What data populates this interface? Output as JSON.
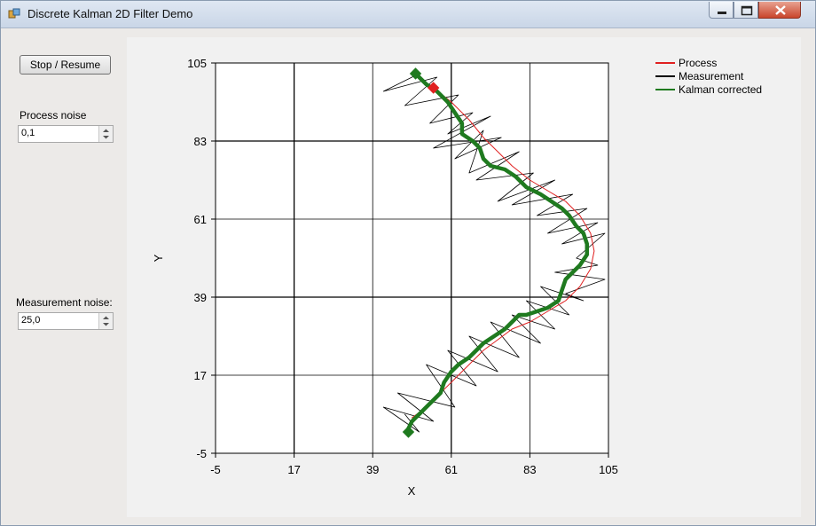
{
  "window": {
    "title": "Discrete Kalman 2D Filter Demo"
  },
  "controls": {
    "stop_resume_label": "Stop / Resume",
    "process_noise_label": "Process noise",
    "process_noise_value": "0,1",
    "measurement_noise_label": "Measurement noise:",
    "measurement_noise_value": "25,0"
  },
  "chart_data": {
    "type": "line",
    "title": "",
    "xlabel": "X",
    "ylabel": "Y",
    "xlim": [
      -5,
      105
    ],
    "ylim": [
      -5,
      105
    ],
    "x_ticks": [
      -5,
      17,
      39,
      61,
      83,
      105
    ],
    "y_ticks": [
      -5,
      17,
      39,
      61,
      83,
      105
    ],
    "grid": true,
    "legend_position": "top-right",
    "series": [
      {
        "name": "Process",
        "color": "#e02020",
        "points": [
          [
            56,
            98
          ],
          [
            61,
            94
          ],
          [
            66,
            89
          ],
          [
            70,
            84
          ],
          [
            74,
            80
          ],
          [
            78,
            76
          ],
          [
            83,
            72
          ],
          [
            88,
            69
          ],
          [
            93,
            66
          ],
          [
            97,
            62
          ],
          [
            100,
            57
          ],
          [
            101,
            52
          ],
          [
            100,
            47
          ],
          [
            97,
            42
          ],
          [
            93,
            38
          ],
          [
            88,
            35
          ],
          [
            83,
            32
          ],
          [
            78,
            30
          ],
          [
            74,
            27
          ],
          [
            70,
            24
          ],
          [
            66,
            20
          ],
          [
            62,
            16
          ],
          [
            58,
            12
          ],
          [
            54,
            8
          ],
          [
            50,
            5
          ]
        ]
      },
      {
        "name": "Measurement",
        "color": "#000000",
        "points": [
          [
            52,
            102
          ],
          [
            42,
            97
          ],
          [
            57,
            101
          ],
          [
            48,
            93
          ],
          [
            63,
            96
          ],
          [
            55,
            88
          ],
          [
            67,
            91
          ],
          [
            60,
            85
          ],
          [
            72,
            90
          ],
          [
            56,
            81
          ],
          [
            75,
            84
          ],
          [
            62,
            78
          ],
          [
            70,
            86
          ],
          [
            66,
            74
          ],
          [
            80,
            80
          ],
          [
            68,
            72
          ],
          [
            84,
            74
          ],
          [
            74,
            66
          ],
          [
            90,
            72
          ],
          [
            78,
            65
          ],
          [
            95,
            68
          ],
          [
            85,
            62
          ],
          [
            99,
            64
          ],
          [
            88,
            57
          ],
          [
            102,
            60
          ],
          [
            92,
            54
          ],
          [
            104,
            57
          ],
          [
            96,
            50
          ],
          [
            102,
            48
          ],
          [
            90,
            46
          ],
          [
            104,
            44
          ],
          [
            93,
            40
          ],
          [
            98,
            38
          ],
          [
            86,
            42
          ],
          [
            94,
            34
          ],
          [
            82,
            38
          ],
          [
            90,
            30
          ],
          [
            78,
            34
          ],
          [
            86,
            26
          ],
          [
            72,
            32
          ],
          [
            80,
            22
          ],
          [
            66,
            28
          ],
          [
            74,
            18
          ],
          [
            60,
            24
          ],
          [
            68,
            14
          ],
          [
            54,
            20
          ],
          [
            62,
            8
          ],
          [
            46,
            12
          ],
          [
            56,
            4
          ],
          [
            42,
            8
          ],
          [
            52,
            1
          ],
          [
            48,
            6
          ]
        ]
      },
      {
        "name": "Kalman corrected",
        "color": "#1f7a1f",
        "points": [
          [
            51,
            102
          ],
          [
            54,
            99
          ],
          [
            57,
            97
          ],
          [
            60,
            94
          ],
          [
            62,
            91
          ],
          [
            64,
            88
          ],
          [
            64,
            85
          ],
          [
            67,
            83
          ],
          [
            69,
            81
          ],
          [
            70,
            78
          ],
          [
            72,
            76
          ],
          [
            76,
            75
          ],
          [
            79,
            73
          ],
          [
            82,
            70
          ],
          [
            86,
            68
          ],
          [
            89,
            66
          ],
          [
            92,
            64
          ],
          [
            94,
            62
          ],
          [
            96,
            59
          ],
          [
            98,
            57
          ],
          [
            99,
            54
          ],
          [
            99,
            51
          ],
          [
            97,
            48
          ],
          [
            95,
            46
          ],
          [
            93,
            44
          ],
          [
            92,
            41
          ],
          [
            91,
            38
          ],
          [
            88,
            36
          ],
          [
            85,
            35
          ],
          [
            82,
            34
          ],
          [
            80,
            34
          ],
          [
            78,
            32
          ],
          [
            76,
            30
          ],
          [
            73,
            28
          ],
          [
            70,
            26
          ],
          [
            68,
            24
          ],
          [
            66,
            22
          ],
          [
            63,
            20
          ],
          [
            61,
            18
          ],
          [
            59,
            15
          ],
          [
            58,
            12
          ],
          [
            56,
            10
          ],
          [
            54,
            8
          ],
          [
            52,
            6
          ],
          [
            50,
            4
          ],
          [
            49,
            2
          ]
        ]
      }
    ],
    "markers": [
      {
        "shape": "diamond",
        "color": "#e02020",
        "x": 56,
        "y": 98
      },
      {
        "shape": "diamond",
        "color": "#1f7a1f",
        "x": 51,
        "y": 102
      },
      {
        "shape": "diamond",
        "color": "#1f7a1f",
        "x": 49,
        "y": 1
      }
    ]
  }
}
